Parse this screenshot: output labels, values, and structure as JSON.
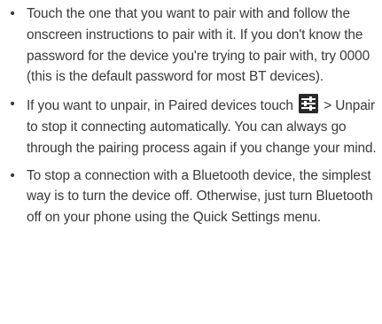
{
  "bullets": [
    {
      "mark": "•",
      "text": "Touch the one that you want to pair with and follow the onscreen instructions to pair with it. If you don't know the password for the device you're trying to pair with, try 0000 (this is the default password for most BT devices)."
    },
    {
      "mark": "•",
      "text_before": "If you want to unpair, in Paired devices touch",
      "icon": "settings-sliders-icon",
      "text_after": "> Unpair to stop it connecting automatically. You can always go through the pairing process again if you change your mind."
    },
    {
      "mark": "•",
      "text": "To stop a connection with a Bluetooth device, the simplest way is to turn the device off. Otherwise, just turn Bluetooth off on your phone using the Quick Settings menu."
    }
  ],
  "colors": {
    "text": "#3a3a3a",
    "icon_background": "#2a2a2a",
    "icon_bars": "#ffffff"
  }
}
